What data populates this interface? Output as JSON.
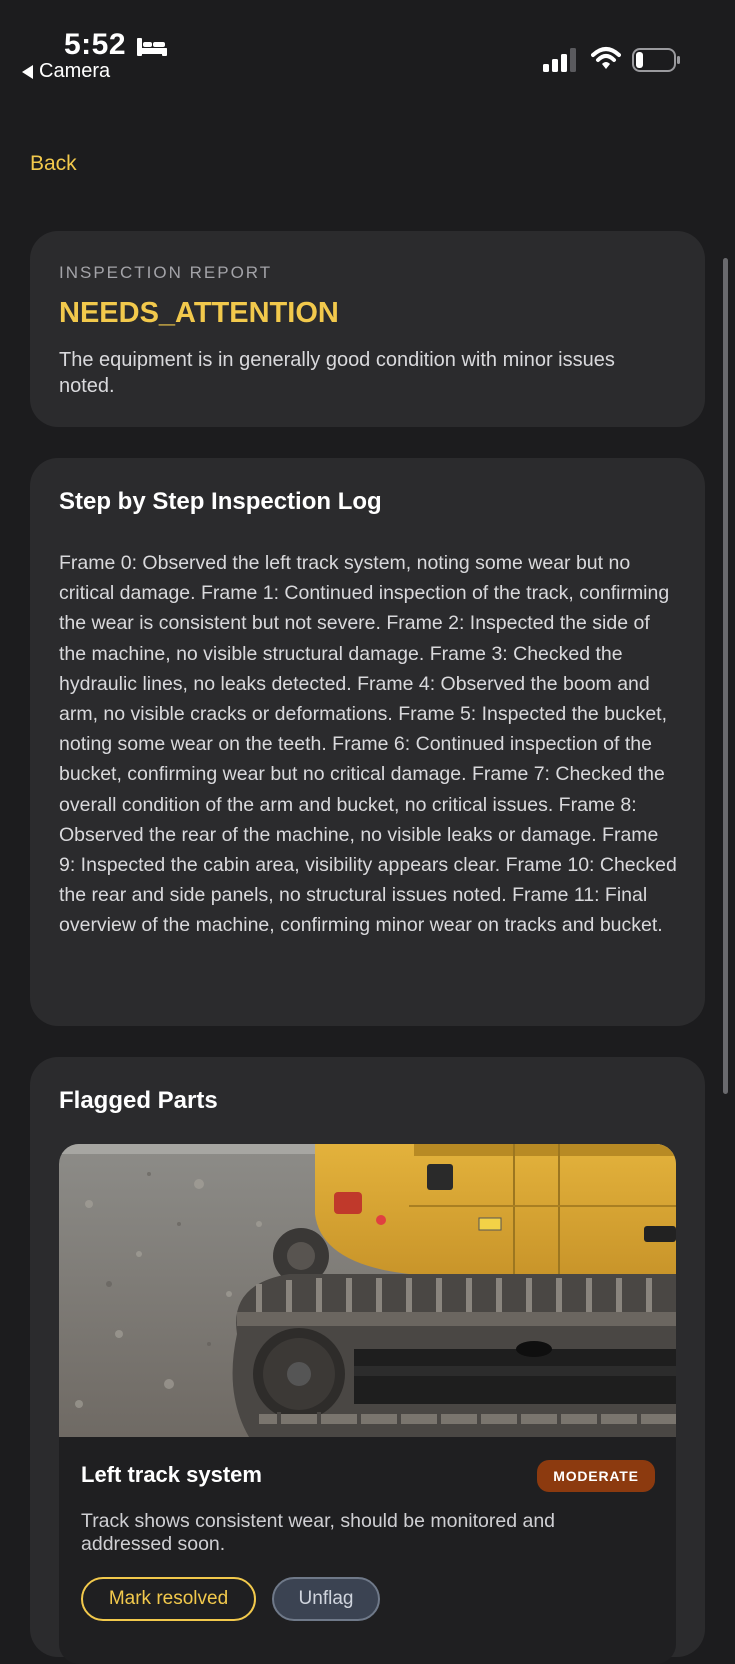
{
  "status_bar": {
    "time": "5:52",
    "back_app": "Camera",
    "icons": [
      "bed-icon",
      "signal-icon",
      "wifi-icon",
      "battery-icon"
    ]
  },
  "nav": {
    "back_label": "Back"
  },
  "report": {
    "label": "INSPECTION REPORT",
    "status": "NEEDS_ATTENTION",
    "summary": "The equipment is in generally good condition with minor issues noted."
  },
  "log": {
    "heading": "Step by Step Inspection Log",
    "text": "Frame 0: Observed the left track system, noting some wear but no critical damage. Frame 1: Continued inspection of the track, confirming the wear is consistent but not severe. Frame 2: Inspected the side of the machine, no visible structural damage. Frame 3: Checked the hydraulic lines, no leaks detected. Frame 4: Observed the boom and arm, no visible cracks or deformations. Frame 5: Inspected the bucket, noting some wear on the teeth. Frame 6: Continued inspection of the bucket, confirming wear but no critical damage. Frame 7: Checked the overall condition of the arm and bucket, no critical issues. Frame 8: Observed the rear of the machine, no visible leaks or damage. Frame 9: Inspected the cabin area, visibility appears clear. Frame 10: Checked the rear and side panels, no structural issues noted. Frame 11: Final overview of the machine, confirming minor wear on tracks and bucket."
  },
  "flagged": {
    "heading": "Flagged Parts",
    "items": [
      {
        "name": "Left track system",
        "severity": "MODERATE",
        "description": "Track shows consistent wear, should be monitored and addressed soon.",
        "resolve_label": "Mark resolved",
        "unflag_label": "Unflag"
      }
    ]
  },
  "colors": {
    "accent": "#f2c94c",
    "background": "#1c1c1e",
    "card": "#2b2b2d",
    "severity_moderate": "#8c3a0f"
  }
}
